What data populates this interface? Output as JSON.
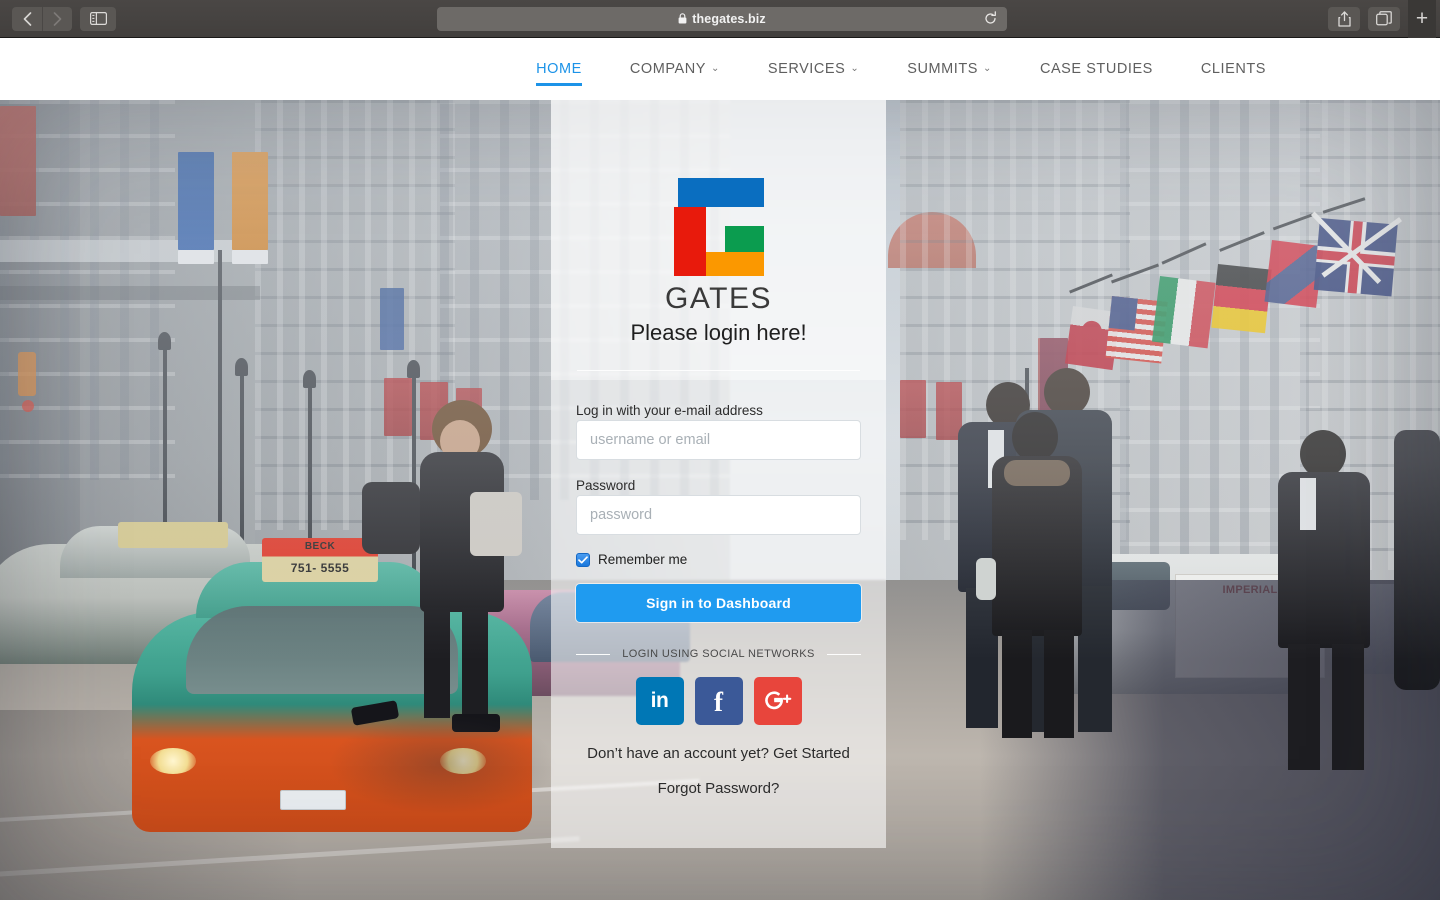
{
  "browser": {
    "url": "thegates.biz",
    "lock_icon": "lock-icon",
    "back_icon": "back-chevron-icon",
    "forward_icon": "forward-chevron-icon",
    "sidebar_icon": "sidebar-toggle-icon",
    "reload_icon": "reload-icon",
    "share_icon": "share-icon",
    "tabs_icon": "show-tabs-icon",
    "newtab_label": "+"
  },
  "site_nav": {
    "active_accent": "#1c93e8",
    "items": [
      {
        "label": "HOME",
        "active": true,
        "caret": ""
      },
      {
        "label": "COMPANY",
        "active": false,
        "caret": "⌄"
      },
      {
        "label": "SERVICES",
        "active": false,
        "caret": "⌄"
      },
      {
        "label": "SUMMITS",
        "active": false,
        "caret": "⌄"
      },
      {
        "label": "CASE STUDIES",
        "active": false,
        "caret": ""
      },
      {
        "label": "CLIENTS",
        "active": false,
        "caret": ""
      }
    ]
  },
  "login_card": {
    "brand": "GATES",
    "tagline": "Please login here!",
    "logo_colors": {
      "blue": "#0a6ec0",
      "red": "#e81a0c",
      "green": "#0b9c4f",
      "orange": "#fb9800"
    },
    "email_label": "Log in with your e-mail address",
    "email_placeholder": "username or email",
    "email_value": "",
    "password_label": "Password",
    "password_placeholder": "password",
    "password_value": "",
    "remember_label": "Remember me",
    "remember_checked": true,
    "submit_label": "Sign in to Dashboard",
    "submit_color": "#1f9bf0",
    "social_divider": "LOGIN USING SOCIAL NETWORKS",
    "social": [
      {
        "name": "linkedin",
        "glyph": "in",
        "color": "#0077b5"
      },
      {
        "name": "facebook",
        "glyph": "f",
        "color": "#3b5998"
      },
      {
        "name": "googleplus",
        "glyph": "G+",
        "color": "#e8453c"
      }
    ],
    "signup_link": "Don’t have an account yet? Get Started",
    "forgot_link": "Forgot Password?"
  },
  "background_photo": {
    "description": "Blurred city street scene with taxis, pedestrians and international flags",
    "taxi_sign_top": "BECK",
    "taxi_sign_phone": "751- 5555",
    "van_ad": "IMPERIAL"
  }
}
